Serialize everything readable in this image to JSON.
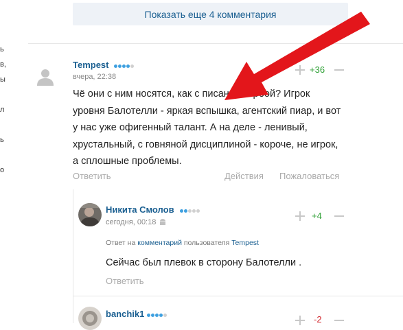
{
  "left_edge": [
    "ь",
    "в,",
    "ы",
    "л",
    "ь",
    "о"
  ],
  "show_more": "Показать еще 4 комментария",
  "comments": [
    {
      "author": "Tempest",
      "time": "вчера, 22:38",
      "score": "+36",
      "text": [
        "Чё они с ним носятся, как с писаной торбой? Игрок",
        "уровня Балотелли - яркая вспышка, агентский пиар, и вот",
        "у нас уже офигенный талант. А на деле - ленивый,",
        "хрустальный, с говняной дисциплиной - короче, не игрок,",
        "а сплошные проблемы."
      ],
      "actions": {
        "reply": "Ответить",
        "more": "Действия",
        "report": "Пожаловаться"
      }
    }
  ],
  "reply": {
    "author": "Никита Смолов",
    "time": "сегодня, 00:18",
    "score": "+4",
    "meta_prefix": "Ответ на",
    "meta_link": "комментарий",
    "meta_middle": "пользователя",
    "meta_user": "Tempest",
    "text": "Сейчас был плевок в сторону Балотелли .",
    "reply_label": "Ответить"
  },
  "reply2": {
    "author": "banchik1",
    "score": "-2"
  },
  "colors": {
    "link": "#1a5f91",
    "positive": "#2ea035",
    "negative": "#d2262c",
    "arrow": "#e3161b"
  }
}
